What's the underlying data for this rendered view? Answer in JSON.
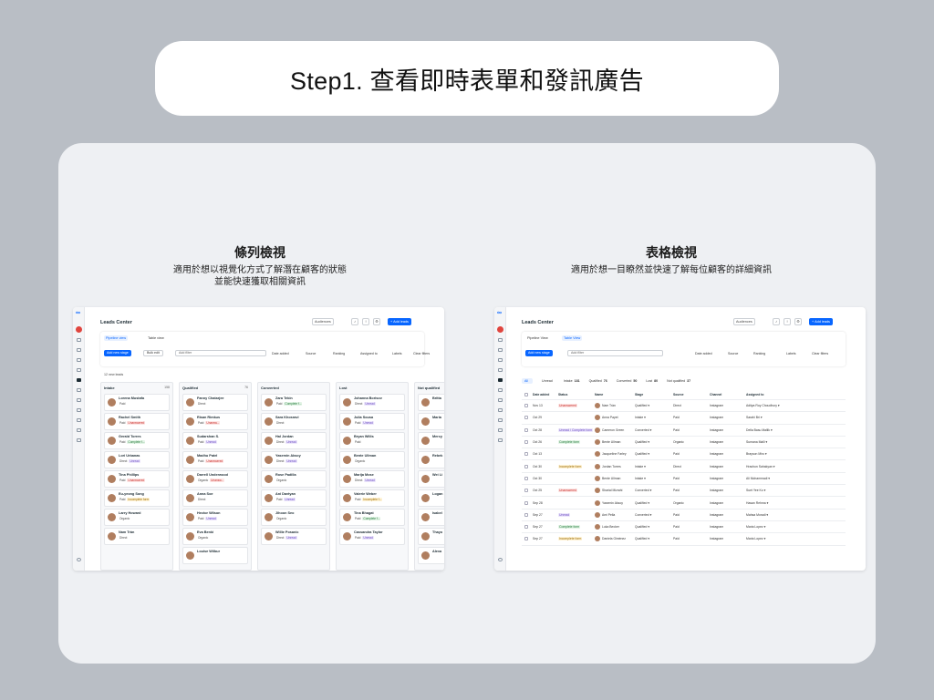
{
  "page_title": "Step1. 查看即時表單和發訊廣告",
  "captions": {
    "pipeline": {
      "title": "條列檢視",
      "desc": "適用於想以視覺化方式了解潛在顧客的狀態\n並能快速獲取相關資訊"
    },
    "table": {
      "title": "表格檢視",
      "desc": "適用於想一目瞭然並快速了解每位顧客的詳細資訊"
    }
  },
  "app": {
    "title": "Leads Center",
    "audiences_label": "Audiences",
    "add_leads_label": "+ Add leads",
    "logo": "∞"
  },
  "pipeline": {
    "tab_pipeline": "Pipeline view",
    "tab_table": "Table view",
    "add_stage": "Add new stage",
    "bulk_edit": "Bulk edit",
    "search_placeholder": "Add filter",
    "filters": [
      "Date added",
      "Source",
      "Ranking",
      "Assigned to",
      "Labels"
    ],
    "clear_filters": "Clear filters",
    "leads_count": "12 new leads",
    "columns": [
      {
        "name": "Intake",
        "count": "158",
        "cards": [
          {
            "name": "Lorena Mustafa",
            "tags": [
              {
                "t": "Paid",
                "c": "plain"
              }
            ]
          },
          {
            "name": "Rachel Smith",
            "tags": [
              {
                "t": "Paid",
                "c": "plain"
              },
              {
                "t": "Unanswered",
                "c": "red"
              }
            ]
          },
          {
            "name": "Gerald Torres",
            "tags": [
              {
                "t": "Paid",
                "c": "plain"
              },
              {
                "t": "Complete f...",
                "c": "green"
              }
            ]
          },
          {
            "name": "Lori Urbanas",
            "tags": [
              {
                "t": "Direct",
                "c": "plain"
              },
              {
                "t": "Unread",
                "c": "purple"
              }
            ]
          },
          {
            "name": "Tina Phillips",
            "tags": [
              {
                "t": "Paid",
                "c": "plain"
              },
              {
                "t": "Unanswered",
                "c": "red"
              }
            ]
          },
          {
            "name": "Eu-yeong Song",
            "tags": [
              {
                "t": "Paid",
                "c": "plain"
              },
              {
                "t": "Incomplete form",
                "c": "yellow"
              }
            ]
          },
          {
            "name": "Larry Howard",
            "tags": [
              {
                "t": "Organic",
                "c": "plain"
              }
            ]
          },
          {
            "name": "Nam Trần",
            "tags": [
              {
                "t": "Direct",
                "c": "plain"
              }
            ]
          }
        ]
      },
      {
        "name": "Qualified",
        "count": "76",
        "cards": [
          {
            "name": "Fanny Chatarjee",
            "tags": [
              {
                "t": "Direct",
                "c": "plain"
              }
            ]
          },
          {
            "name": "Risan Rimkus",
            "tags": [
              {
                "t": "Paid",
                "c": "plain"
              },
              {
                "t": "Unansw...",
                "c": "red"
              }
            ]
          },
          {
            "name": "Sudarshan S.",
            "tags": [
              {
                "t": "Paid",
                "c": "plain"
              },
              {
                "t": "Unread",
                "c": "purple"
              }
            ]
          },
          {
            "name": "Madhu Patel",
            "tags": [
              {
                "t": "Paid",
                "c": "plain"
              },
              {
                "t": "Unanswered",
                "c": "red"
              }
            ]
          },
          {
            "name": "Darrell Underwood",
            "tags": [
              {
                "t": "Organic",
                "c": "plain"
              },
              {
                "t": "Unansw...",
                "c": "red"
              }
            ]
          },
          {
            "name": "Anna Soe",
            "tags": [
              {
                "t": "Direct",
                "c": "plain"
              }
            ]
          },
          {
            "name": "Hector Wilson",
            "tags": [
              {
                "t": "Paid",
                "c": "plain"
              },
              {
                "t": "Unread",
                "c": "purple"
              }
            ]
          },
          {
            "name": "Eva Benki",
            "tags": [
              {
                "t": "Organic",
                "c": "plain"
              }
            ]
          },
          {
            "name": "Louise Wilbur",
            "tags": []
          }
        ]
      },
      {
        "name": "Converted",
        "count": "",
        "cards": [
          {
            "name": "Zara Tekin",
            "tags": [
              {
                "t": "Paid",
                "c": "plain"
              },
              {
                "t": "Complete f...",
                "c": "green"
              }
            ]
          },
          {
            "name": "Sara Khosravi",
            "tags": [
              {
                "t": "Direct",
                "c": "plain"
              }
            ]
          },
          {
            "name": "Hal Jordan",
            "tags": [
              {
                "t": "Direct",
                "c": "plain"
              },
              {
                "t": "Unread",
                "c": "purple"
              }
            ]
          },
          {
            "name": "Yasemin Aksoy",
            "tags": [
              {
                "t": "Direct",
                "c": "plain"
              },
              {
                "t": "Unread",
                "c": "purple"
              }
            ]
          },
          {
            "name": "Rose Padilla",
            "tags": [
              {
                "t": "Organic",
                "c": "plain"
              }
            ]
          },
          {
            "name": "Ani Davtyan",
            "tags": [
              {
                "t": "Paid",
                "c": "plain"
              },
              {
                "t": "Unread",
                "c": "purple"
              }
            ]
          },
          {
            "name": "Jihoon Seo",
            "tags": [
              {
                "t": "Organic",
                "c": "plain"
              }
            ]
          },
          {
            "name": "Willie Posanic",
            "tags": [
              {
                "t": "Direct",
                "c": "plain"
              },
              {
                "t": "Unread",
                "c": "purple"
              }
            ]
          }
        ]
      },
      {
        "name": "Lost",
        "count": "",
        "cards": [
          {
            "name": "Johanna Borisov",
            "tags": [
              {
                "t": "Direct",
                "c": "plain"
              },
              {
                "t": "Unread",
                "c": "purple"
              }
            ]
          },
          {
            "name": "Julia Sousa",
            "tags": [
              {
                "t": "Paid",
                "c": "plain"
              },
              {
                "t": "Unread",
                "c": "purple"
              }
            ]
          },
          {
            "name": "Bryan Willis",
            "tags": [
              {
                "t": "Paid",
                "c": "plain"
              }
            ]
          },
          {
            "name": "Bente Ullman",
            "tags": [
              {
                "t": "Organic",
                "c": "plain"
              }
            ]
          },
          {
            "name": "Marija Mose",
            "tags": [
              {
                "t": "Direct",
                "c": "plain"
              },
              {
                "t": "Unread",
                "c": "purple"
              }
            ]
          },
          {
            "name": "Valerie Weber",
            "tags": [
              {
                "t": "Paid",
                "c": "plain"
              },
              {
                "t": "Incomplete f...",
                "c": "yellow"
              }
            ]
          },
          {
            "name": "Tina Bhagat",
            "tags": [
              {
                "t": "Paid",
                "c": "plain"
              },
              {
                "t": "Complete f...",
                "c": "green"
              }
            ]
          },
          {
            "name": "Cassandra Taylor",
            "tags": [
              {
                "t": "Paid",
                "c": "plain"
              },
              {
                "t": "Unread",
                "c": "purple"
              }
            ]
          }
        ]
      },
      {
        "name": "Not qualified",
        "count": "",
        "cards": [
          {
            "name": "Britta",
            "tags": []
          },
          {
            "name": "Maria",
            "tags": []
          },
          {
            "name": "Mercy",
            "tags": []
          },
          {
            "name": "Rebek",
            "tags": []
          },
          {
            "name": "Wei Li",
            "tags": []
          },
          {
            "name": "Logan",
            "tags": []
          },
          {
            "name": "Isabel",
            "tags": []
          },
          {
            "name": "Thayo",
            "tags": []
          },
          {
            "name": "Alexa",
            "tags": []
          }
        ]
      }
    ]
  },
  "table": {
    "tab_pipeline": "Pipeline View",
    "tab_table": "Table View",
    "add_stage": "Add new stage",
    "search_placeholder": "Add filter",
    "filters": [
      "Date added",
      "Source",
      "Ranking",
      "Labels"
    ],
    "clear_filters": "Clear filters",
    "stage_tabs": [
      {
        "label": "All",
        "count": ""
      },
      {
        "label": "Unread",
        "count": ""
      },
      {
        "label": "Intake",
        "count": "181"
      },
      {
        "label": "Qualified",
        "count": "76"
      },
      {
        "label": "Converted",
        "count": "50"
      },
      {
        "label": "Lost",
        "count": "80"
      },
      {
        "label": "Not qualified",
        "count": "37"
      }
    ],
    "headers": [
      "Date added",
      "Status",
      "Name",
      "Stage",
      "Source",
      "Channel",
      "Assigned to"
    ],
    "rows": [
      [
        "Nov 13",
        "Unanswered",
        "Nam Trần",
        "Qualified ▾",
        "Direct",
        "Instagram",
        "Aditya Roy Choudhury ▾"
      ],
      [
        "Oct 29",
        "",
        "Anna Payet",
        "Intake ▾",
        "Paid",
        "Instagram",
        "Sarahi Bri ▾"
      ],
      [
        "Oct 28",
        "Unread / Complete form",
        "Cameron Green",
        "Converted ▾",
        "Paid",
        "Instagram",
        "Della Basu Mallik ▾"
      ],
      [
        "Oct 26",
        "Complete form",
        "Bente Ullman",
        "Qualified ▾",
        "Organic",
        "Instagram",
        "Sumana Malli ▾"
      ],
      [
        "Oct 13",
        "",
        "Jacqueline Farley",
        "Qualified ▾",
        "Paid",
        "Instagram",
        "Brayson Miro ▾"
      ],
      [
        "Oct 30",
        "Incomplete form",
        "Jordan Torres",
        "Intake ▾",
        "Direct",
        "Instagram",
        "Hrachun Sahakyan ▾"
      ],
      [
        "Oct 30",
        "",
        "Bente Ullman",
        "Intake ▾",
        "Paid",
        "Instagram",
        "Ali Mohammadi ▾"
      ],
      [
        "Oct 25",
        "Unanswered",
        "Sharial Mizrahi",
        "Converted ▾",
        "Paid",
        "Instagram",
        "Suet Yee Ko ▾"
      ],
      [
        "Sep 28",
        "",
        "Yasemin Aksoy",
        "Qualified ▾",
        "Organic",
        "Instagram",
        "Hasan Rehma ▾"
      ],
      [
        "Sep 27",
        "Unread",
        "Ami Pella",
        "Converted ▾",
        "Paid",
        "Instagram",
        "Mahsa Moradi ▾"
      ],
      [
        "Sep 27",
        "Complete form",
        "Luka Becker",
        "Qualified ▾",
        "Paid",
        "Instagram",
        "Maria Lopez ▾"
      ],
      [
        "Sep 27",
        "Incomplete form",
        "Daniela Giménez",
        "Qualified ▾",
        "Paid",
        "Instagram",
        "Maria Lopez ▾"
      ]
    ]
  }
}
